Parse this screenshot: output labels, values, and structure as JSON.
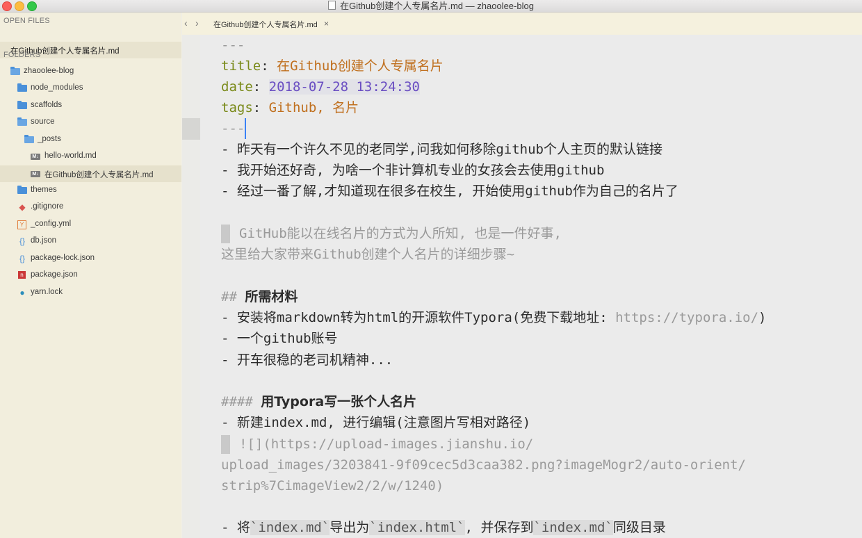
{
  "window": {
    "title": "在Github创建个人专属名片.md — zhaoolee-blog"
  },
  "sidebar": {
    "open_files_label": "OPEN FILES",
    "open_file": "在Github创建个人专属名片.md",
    "folders_label": "FOLDERS",
    "tree": [
      {
        "label": "zhaoolee-blog",
        "icon": "folder-open-icon"
      },
      {
        "label": "node_modules",
        "icon": "folder-icon"
      },
      {
        "label": "scaffolds",
        "icon": "folder-icon"
      },
      {
        "label": "source",
        "icon": "folder-open-icon"
      },
      {
        "label": "_posts",
        "icon": "folder-open-icon"
      },
      {
        "label": "hello-world.md",
        "icon": "markdown-file-icon"
      },
      {
        "label": "在Github创建个人专属名片.md",
        "icon": "markdown-file-icon"
      },
      {
        "label": "themes",
        "icon": "folder-icon"
      },
      {
        "label": ".gitignore",
        "icon": "git-icon"
      },
      {
        "label": "_config.yml",
        "icon": "yaml-icon"
      },
      {
        "label": "db.json",
        "icon": "json-icon"
      },
      {
        "label": "package-lock.json",
        "icon": "json-icon"
      },
      {
        "label": "package.json",
        "icon": "npm-icon"
      },
      {
        "label": "yarn.lock",
        "icon": "yarn-icon"
      }
    ]
  },
  "tabs": [
    {
      "label": "在Github创建个人专属名片.md",
      "close": "×"
    }
  ],
  "nav": {
    "back": "‹",
    "forward": "›"
  },
  "editor": {
    "fm_open": "---",
    "title_key": "title",
    "title_val": "在Github创建个人专属名片",
    "date_key": "date",
    "date_val": "2018-07-28 13:24:30",
    "tags_key": "tags",
    "tags_val": "Github, 名片",
    "fm_close": "---",
    "l1": "- 昨天有一个许久不见的老同学,问我如何移除github个人主页的默认链接",
    "l2": "- 我开始还好奇, 为啥一个非计算机专业的女孩会去使用github",
    "l3": "- 经过一番了解,才知道现在很多在校生, 开始使用github作为自己的名片了",
    "q1": "GitHub能以在线名片的方式为人所知, 也是一件好事,",
    "q2": "这里给大家带来Github创建个人名片的详细步骤~",
    "h2_mark": "##",
    "h2": "所需材料",
    "m1_a": "- 安装将markdown转为html的开源软件Typora(免费下载地址: ",
    "m1_url": "https://typora.io/",
    "m1_b": ")",
    "m2": "-  一个github账号",
    "m3": "- 开车很稳的老司机精神...",
    "h4_mark": "####",
    "h4": "用Typora写一张个人名片",
    "s1": "- 新建index.md, 进行编辑(注意图片写相对路径)",
    "img1": "![](https://upload-images.jianshu.io/",
    "img2": "upload_images/3203841-9f09cec5d3caa382.png?imageMogr2/auto-orient/",
    "img3": "strip%7CimageView2/2/w/1240)",
    "s2_a": "- 将",
    "s2_c1": "`index.md`",
    "s2_b": "导出为",
    "s2_c2": "`index.html`",
    "s2_c": ", 并保存到",
    "s2_c3": "`index.md`",
    "s2_d": "同级目录"
  }
}
